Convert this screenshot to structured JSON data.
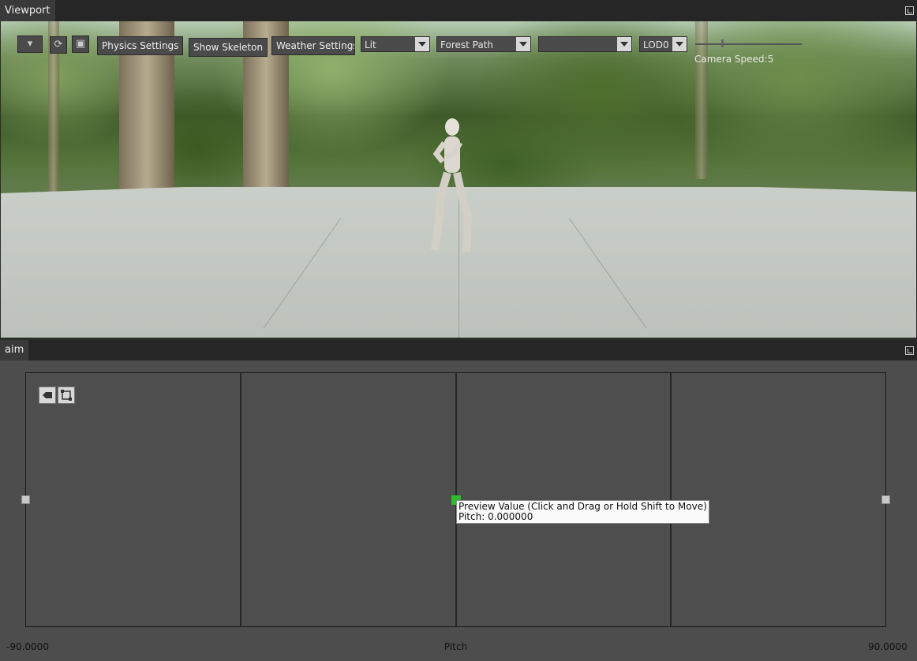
{
  "viewport_panel": {
    "tab_label": "Viewport",
    "toolbar": {
      "physics_settings_label": "Physics Settings",
      "show_skeleton_label": "Show Skeleton",
      "weather_settings_label": "Weather Settings",
      "view_mode_value": "Lit",
      "environment_value": "Forest Path",
      "third_combo_value": "",
      "lod_value": "LOD0",
      "camera_speed_text": "Camera Speed:5"
    }
  },
  "aim_panel": {
    "tab_label": "aim",
    "tooltip": {
      "line1": "Preview Value (Click and Drag or Hold Shift to Move)",
      "line2": "Pitch: 0.000000"
    },
    "axis": {
      "min_label": "-90.0000",
      "name_label": "Pitch",
      "max_label": "90.0000"
    }
  },
  "icons": [
    "dropdown-icon",
    "refresh-icon",
    "fullscreen-icon",
    "pin-icon",
    "tag-icon",
    "fit-view-icon",
    "cursor-icon"
  ]
}
